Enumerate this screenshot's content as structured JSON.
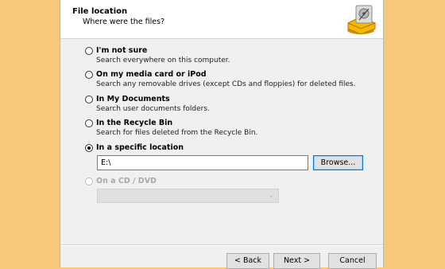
{
  "header": {
    "title": "File location",
    "subtitle": "Where were the files?",
    "icon": "hard-drive-rescue-icon"
  },
  "options": [
    {
      "label": "I'm not sure",
      "description": "Search everywhere on this computer.",
      "checked": false
    },
    {
      "label": "On my media card or iPod",
      "description": "Search any removable drives (except CDs and floppies) for deleted files.",
      "checked": false
    },
    {
      "label": "In My Documents",
      "description": "Search user documents folders.",
      "checked": false
    },
    {
      "label": "In the Recycle Bin",
      "description": "Search for files deleted from the Recycle Bin.",
      "checked": false
    },
    {
      "label": "In a specific location",
      "description": "",
      "checked": true
    },
    {
      "label": "On a CD / DVD",
      "description": "",
      "checked": false,
      "disabled": true
    }
  ],
  "location": {
    "path_value": "E:\\",
    "browse_label": "Browse..."
  },
  "cd_select": {
    "value": ""
  },
  "footer": {
    "back_label": "< Back",
    "next_label": "Next >",
    "cancel_label": "Cancel"
  }
}
